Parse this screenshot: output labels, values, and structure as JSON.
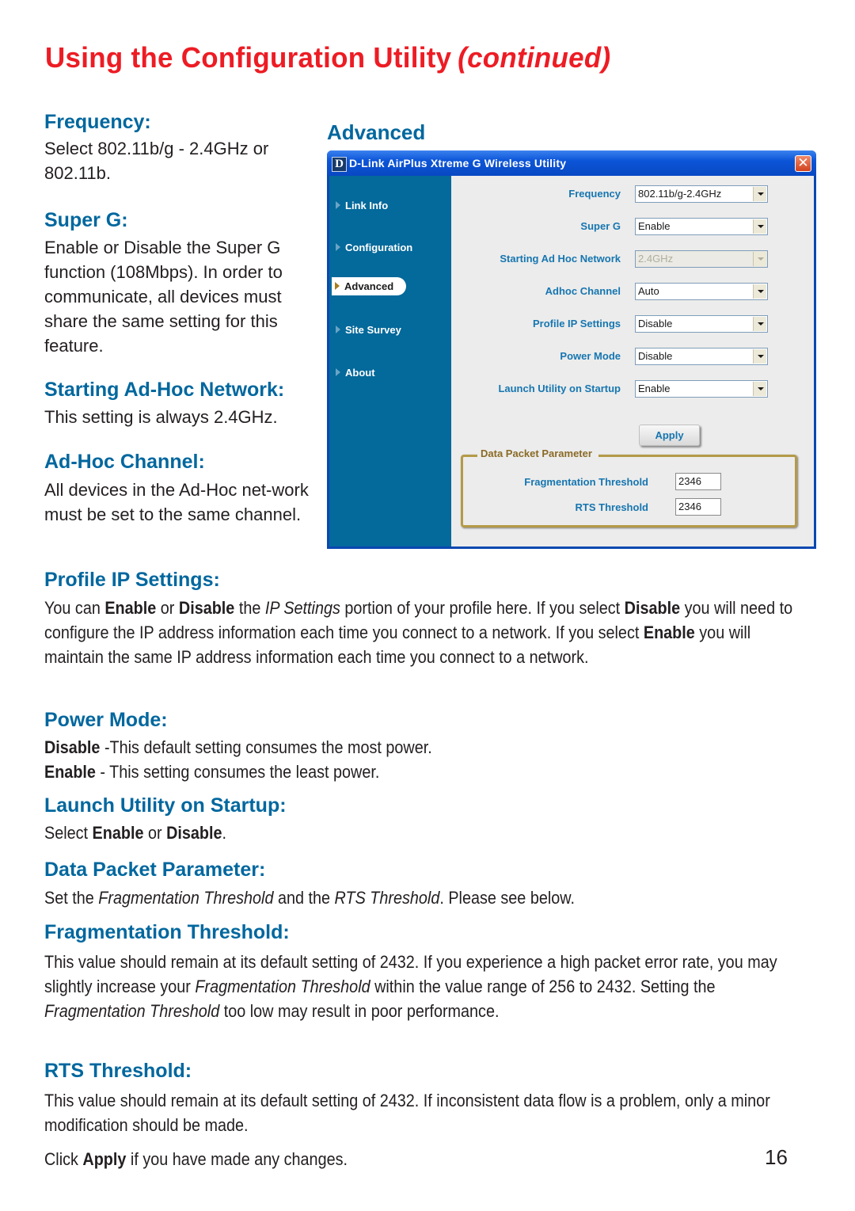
{
  "page": {
    "title": "Using the Configuration Utility",
    "title_suffix": "(continued)",
    "page_number": "16"
  },
  "sections": {
    "frequency": {
      "heading": "Frequency:",
      "body": "Select 802.11b/g - 2.4GHz or 802.11b."
    },
    "super_g": {
      "heading": "Super G:",
      "body": "Enable or Disable the Super G function (108Mbps). In order to communicate, all devices must share the same setting for this feature."
    },
    "starting_adhoc": {
      "heading": "Starting Ad-Hoc Network:",
      "body": "This setting is always 2.4GHz."
    },
    "adhoc_channel": {
      "heading": "Ad-Hoc Channel:",
      "body": "All devices in the Ad-Hoc net-work must be set to the same channel."
    },
    "profile_ip": {
      "heading": "Profile IP Settings:",
      "t1": "You can ",
      "b1": "Enable",
      "t2": " or ",
      "b2": "Disable",
      "t3": " the ",
      "i1": "IP Settings",
      "t4": " portion of your profile  here. If you select ",
      "b3": "Disable",
      "t5": " you will need to configure the IP address information each time you connect to a network. If you select ",
      "b4": "Enable",
      "t6": " you will maintain the same IP address information each time you connect to a network."
    },
    "power_mode": {
      "heading": "Power Mode:",
      "line1_bold": "Disable",
      "line1_text": " -This default setting consumes the most power.",
      "line2_bold": "Enable",
      "line2_text": " - This setting consumes the least power."
    },
    "launch_utility": {
      "heading": "Launch Utility on Startup:",
      "t1": "Select ",
      "b1": "Enable",
      "t2": " or ",
      "b2": "Disable",
      "t3": "."
    },
    "data_packet": {
      "heading": "Data Packet Parameter:",
      "t1": "Set the ",
      "i1": "Fragmentation Threshold",
      "t2": " and the ",
      "i2": "RTS Threshold",
      "t3": ". Please see below."
    },
    "fragmentation": {
      "heading": "Fragmentation Threshold:",
      "t1": "This value should remain at its default setting of 2432. If you experience a high packet error rate, you may slightly increase your ",
      "i1": "Fragmentation Threshold",
      "t2": " within the value range of 256 to 2432. Setting the ",
      "i2": "Fragmentation Threshold",
      "t3": " too low may result in poor performance."
    },
    "rts": {
      "heading": "RTS Threshold:",
      "body": "This value should remain at its default setting of 2432. If inconsistent data flow is a problem, only a minor modification should be made."
    },
    "footer": {
      "t1": "Click ",
      "b1": "Apply",
      "t2": " if you have made any changes."
    }
  },
  "screenshot": {
    "caption": "Advanced",
    "window_title": "D-Link AirPlus Xtreme G Wireless Utility",
    "logo_letter": "D",
    "close_glyph": "✕",
    "nav": [
      {
        "label": "Link Info",
        "active": false
      },
      {
        "label": "Configuration",
        "active": false
      },
      {
        "label": "Advanced",
        "active": true
      },
      {
        "label": "Site Survey",
        "active": false
      },
      {
        "label": "About",
        "active": false
      }
    ],
    "fields": [
      {
        "label": "Frequency",
        "value": "802.11b/g-2.4GHz",
        "disabled": false
      },
      {
        "label": "Super G",
        "value": "Enable",
        "disabled": false
      },
      {
        "label": "Starting Ad Hoc Network",
        "value": "2.4GHz",
        "disabled": true
      },
      {
        "label": "Adhoc Channel",
        "value": "Auto",
        "disabled": false
      },
      {
        "label": "Profile IP Settings",
        "value": "Disable",
        "disabled": false
      },
      {
        "label": "Power Mode",
        "value": "Disable",
        "disabled": false
      },
      {
        "label": "Launch Utility on Startup",
        "value": "Enable",
        "disabled": false
      }
    ],
    "apply_label": "Apply",
    "group": {
      "title": "Data Packet Parameter",
      "fragmentation_label": "Fragmentation Threshold",
      "fragmentation_value": "2346",
      "rts_label": "RTS Threshold",
      "rts_value": "2346"
    }
  },
  "colors": {
    "title_red": "#ed1c24",
    "heading_blue": "#00679e",
    "nav_blue": "#04699b",
    "titlebar_blue": "#0c55d8"
  }
}
